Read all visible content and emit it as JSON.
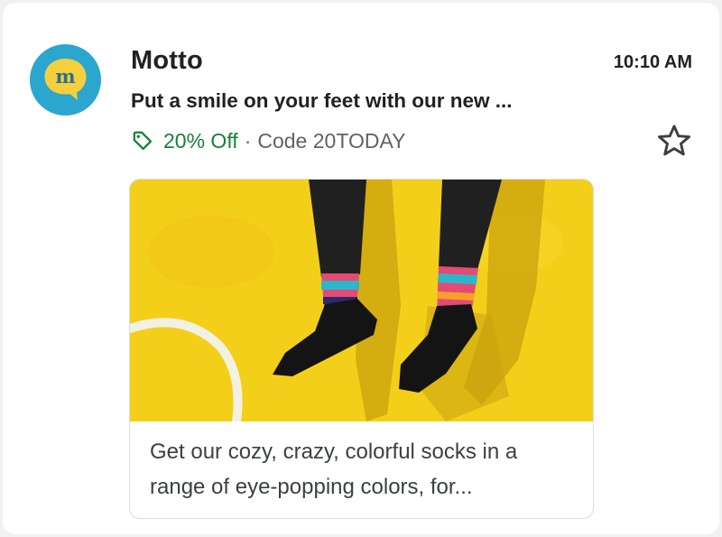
{
  "email": {
    "sender": "Motto",
    "time": "10:10 AM",
    "subject": "Put a smile on your feet with our new ...",
    "offer": "20% Off",
    "separator": "·",
    "code": "Code 20TODAY",
    "avatar_letter": "m",
    "starred": false
  },
  "promo": {
    "text": "Get our cozy, crazy, colorful socks in a range of eye-popping colors, for..."
  },
  "icons": {
    "avatar": "motto-logo-speech-bubble",
    "tag": "tag-icon",
    "star": "star-outline-icon"
  },
  "colors": {
    "avatar_bg": "#2ba6cf",
    "avatar_bubble": "#f6cf3e",
    "offer_green": "#188038",
    "promo_bg": "#f4cf1a",
    "text_dark": "#202124",
    "text_grey": "#5f6368"
  }
}
